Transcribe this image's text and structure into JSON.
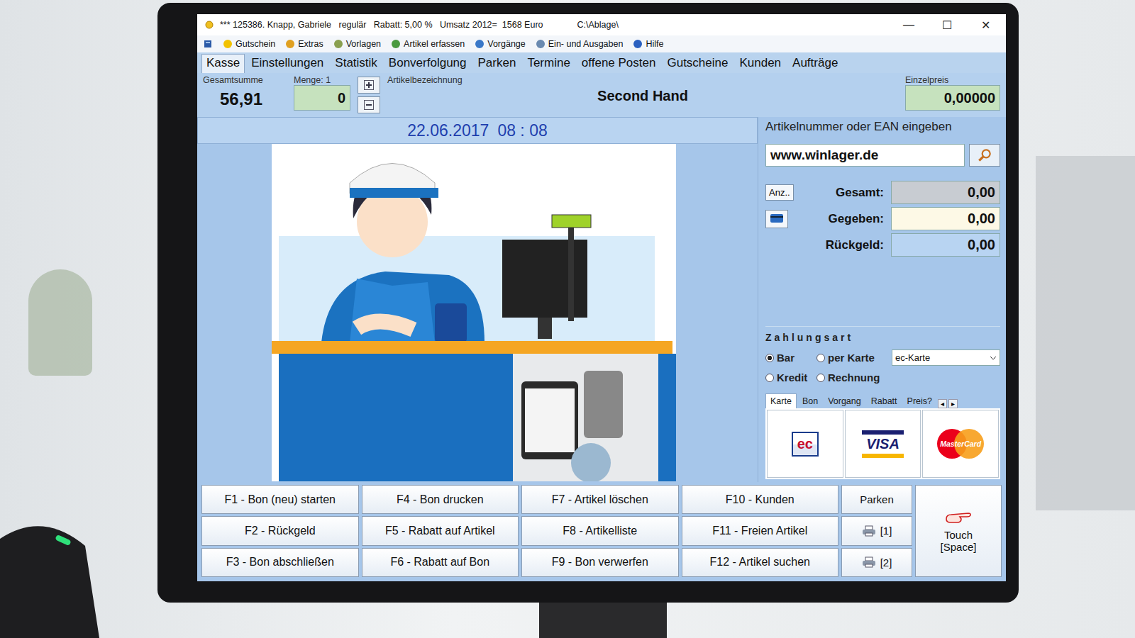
{
  "window": {
    "title": "*** 125386. Knapp, Gabriele   regulär   Rabatt: 5,00 %   Umsatz 2012=  1568 Euro",
    "path": "C:\\Ablage\\",
    "controls": [
      "—",
      "☐",
      "✕"
    ]
  },
  "toolbar": [
    {
      "label": "Gutschein"
    },
    {
      "label": "Extras"
    },
    {
      "label": "Vorlagen"
    },
    {
      "label": "Artikel erfassen"
    },
    {
      "label": "Vorgänge"
    },
    {
      "label": "Ein- und Ausgaben"
    },
    {
      "label": "Hilfe"
    }
  ],
  "tabs": [
    {
      "label": "Kasse",
      "selected": true
    },
    {
      "label": "Einstellungen",
      "selected": false
    },
    {
      "label": "Statistik",
      "selected": false
    },
    {
      "label": "Bonverfolgung",
      "selected": false
    },
    {
      "label": "Parken",
      "selected": false
    },
    {
      "label": "Termine",
      "selected": false
    },
    {
      "label": "offene Posten",
      "selected": false
    },
    {
      "label": "Gutscheine",
      "selected": false
    },
    {
      "label": "Kunden",
      "selected": false
    },
    {
      "label": "Aufträge",
      "selected": false
    }
  ],
  "summary": {
    "total_label": "Gesamtsumme",
    "total": "56,91",
    "qty_label": "Menge: 1",
    "qty": "0",
    "article_label": "Artikelbezeichnung",
    "article": "Second Hand",
    "price_label": "Einzelpreis",
    "price": "0,00000"
  },
  "datetime": {
    "date": "22.06.2017",
    "time": "08 : 08"
  },
  "ean": {
    "label": "Artikelnummer oder EAN eingeben",
    "value": "www.winlager.de"
  },
  "amounts": {
    "count_button": "Anz..",
    "rows": [
      {
        "label": "Gesamt:",
        "value": "0,00",
        "kind": "total"
      },
      {
        "label": "Gegeben:",
        "value": "0,00",
        "kind": "given"
      },
      {
        "label": "Rückgeld:",
        "value": "0,00",
        "kind": "change"
      }
    ]
  },
  "payment": {
    "title": "Zahlungsart",
    "options": [
      {
        "label": "Bar",
        "selected": true
      },
      {
        "label": "per Karte",
        "selected": false
      },
      {
        "label": "Kredit",
        "selected": false
      },
      {
        "label": "Rechnung",
        "selected": false
      }
    ],
    "card_type": "ec-Karte"
  },
  "subtabs": [
    {
      "label": "Karte",
      "selected": true
    },
    {
      "label": "Bon",
      "selected": false
    },
    {
      "label": "Vorgang",
      "selected": false
    },
    {
      "label": "Rabatt",
      "selected": false
    },
    {
      "label": "Preis?",
      "selected": false
    }
  ],
  "subtab_arrows": [
    "◂",
    "▸"
  ],
  "cards": [
    {
      "name": "ec",
      "text": "ec"
    },
    {
      "name": "visa",
      "text": "VISA"
    },
    {
      "name": "mastercard",
      "text": "MasterCard"
    }
  ],
  "function_keys": [
    "F1 - Bon (neu) starten",
    "F2 - Rückgeld",
    "F3 - Bon abschließen",
    "F4 - Bon drucken",
    "F5 - Rabatt auf Artikel",
    "F6 - Rabatt auf Bon",
    "F7 - Artikel löschen",
    "F8 - Artikelliste",
    "F9 - Bon verwerfen",
    "F10 - Kunden",
    "F11 - Freien Artikel",
    "F12 - Artikel suchen"
  ],
  "park": {
    "label": "Parken",
    "printers": [
      "[1]",
      "[2]"
    ]
  },
  "touch": {
    "lines": [
      "Touch",
      "[Space]"
    ]
  }
}
